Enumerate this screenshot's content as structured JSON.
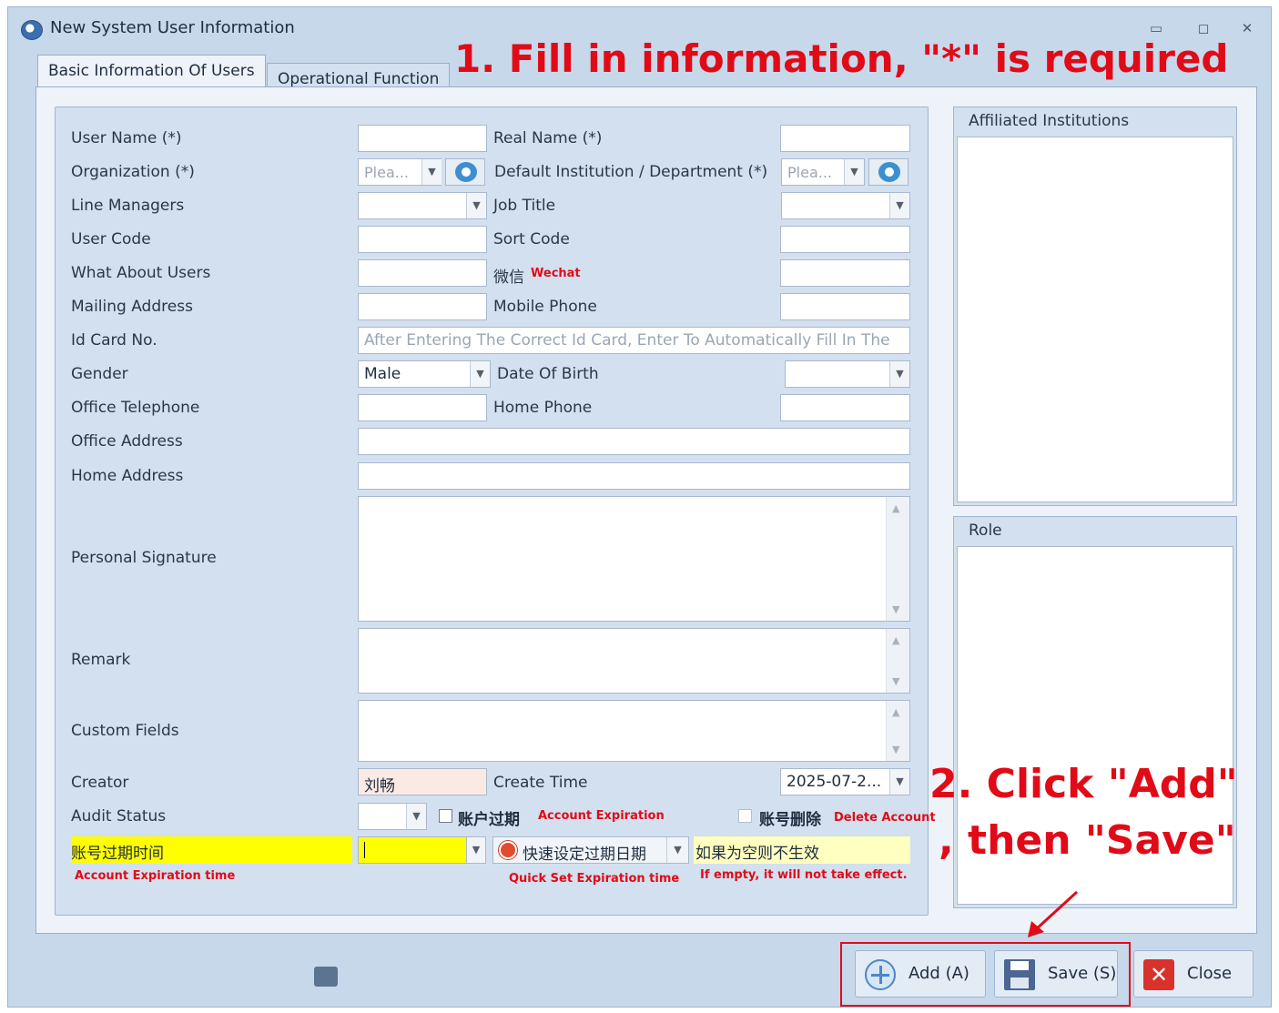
{
  "window": {
    "title": "New System User Information",
    "controls": {
      "minimize": "▭",
      "maximize": "◻",
      "close": "✕"
    }
  },
  "annotations": {
    "step1": "1. Fill in information, \"*\" is required",
    "step2_line1": "2. Click \"Add\"",
    "step2_line2": ", then \"Save\"",
    "wechat": "Wechat",
    "account_expiration": "Account Expiration",
    "delete_account": "Delete Account",
    "account_expiration_time": "Account Expiration time",
    "quick_set": "Quick Set Expiration time",
    "if_empty": "If empty, it will not take effect."
  },
  "tabs": [
    {
      "label": "Basic Information Of Users",
      "active": true
    },
    {
      "label": "Operational Function",
      "active": false
    }
  ],
  "form": {
    "user_name_label": "User Name (*)",
    "real_name_label": "Real Name (*)",
    "organization_label": "Organization (*)",
    "organization_placeholder": "Plea...",
    "default_institution_label": "Default Institution / Department (*)",
    "default_institution_placeholder": "Plea...",
    "line_managers_label": "Line Managers",
    "job_title_label": "Job Title",
    "user_code_label": "User Code",
    "sort_code_label": "Sort Code",
    "what_about_users_label": "What About Users",
    "wechat_label": "微信",
    "mailing_address_label": "Mailing Address",
    "mobile_phone_label": "Mobile Phone",
    "id_card_label": "Id Card No.",
    "id_card_placeholder": "After Entering The Correct Id Card, Enter To Automatically Fill In The",
    "gender_label": "Gender",
    "gender_value": "Male",
    "date_of_birth_label": "Date Of Birth",
    "office_telephone_label": "Office Telephone",
    "home_phone_label": "Home Phone",
    "office_address_label": "Office Address",
    "home_address_label": "Home Address",
    "personal_signature_label": "Personal Signature",
    "remark_label": "Remark",
    "custom_fields_label": "Custom Fields",
    "creator_label": "Creator",
    "creator_value": "刘畅",
    "create_time_label": "Create Time",
    "create_time_value": "2025-07-2...",
    "audit_status_label": "Audit Status",
    "account_expired_label": "账户过期",
    "account_delete_label": "账号删除",
    "expiration_time_label": "账号过期时间",
    "quick_set_label": "快速设定过期日期",
    "empty_hint": "如果为空则不生效"
  },
  "side": {
    "affiliated_institutions": "Affiliated Institutions",
    "role": "Role"
  },
  "buttons": {
    "add": "Add (A)",
    "save": "Save (S)",
    "close": "Close"
  },
  "colors": {
    "annotation_red": "#e10b17",
    "highlight_yellow": "#ffff00",
    "pale_yellow": "#ffffc0",
    "window_bg": "#c8d8eb"
  }
}
